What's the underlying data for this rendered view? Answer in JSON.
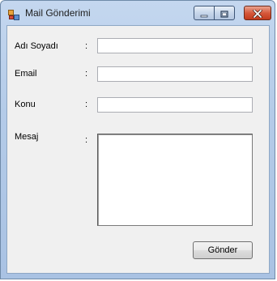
{
  "window": {
    "title": "Mail Gönderimi",
    "icon": "windows-form-icon",
    "controls": {
      "minimize_icon": "minimize-icon",
      "maximize_icon": "maximize-icon",
      "close_icon": "close-icon"
    }
  },
  "form": {
    "name_label": "Adı Soyadı",
    "email_label": "Email",
    "subject_label": "Konu",
    "message_label": "Mesaj",
    "separator": ":",
    "name_value": "",
    "email_value": "",
    "subject_value": "",
    "message_value": "",
    "send_label": "Gönder"
  },
  "colors": {
    "title_bar": "#b9cfea",
    "client_bg": "#f0f0f0",
    "close_button": "#c8442a"
  }
}
